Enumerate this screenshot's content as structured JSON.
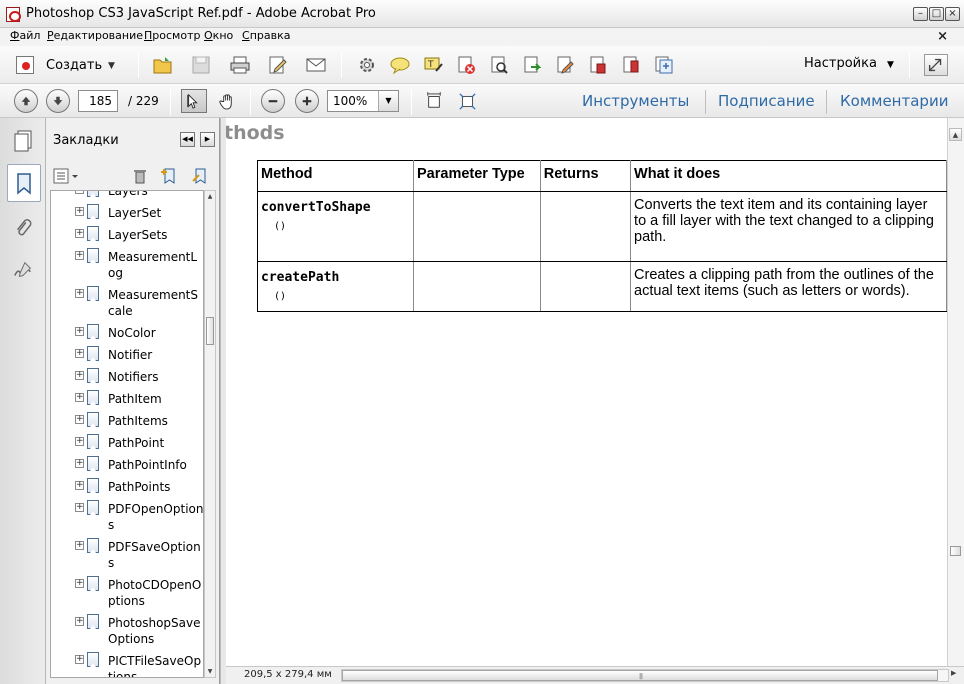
{
  "window": {
    "title": "Photoshop CS3 JavaScript Ref.pdf - Adobe Acrobat Pro",
    "minimize": "–",
    "maximize": "□",
    "close": "×"
  },
  "menu": {
    "items": [
      "Файл",
      "Редактирование",
      "Просмотр",
      "Окно",
      "Справка"
    ],
    "close_doc": "×"
  },
  "toolbar": {
    "create_label": "Создать",
    "create_arrow": "▼",
    "settings_label": "Настройка",
    "settings_arrow": "▼"
  },
  "navigation": {
    "current_page": "185",
    "total_pages": "/ 229",
    "zoom": "100%",
    "zoom_arrow": "▼",
    "panel_tabs": [
      "Инструменты",
      "Подписание",
      "Комментарии"
    ]
  },
  "bookmarks": {
    "title": "Закладки",
    "items": [
      "Layers",
      "LayerSet",
      "LayerSets",
      "MeasurementLog",
      "MeasurementScale",
      "NoColor",
      "Notifier",
      "Notifiers",
      "PathItem",
      "PathItems",
      "PathPoint",
      "PathPointInfo",
      "PathPoints",
      "PDFOpenOptions",
      "PDFSaveOptions",
      "PhotoCDOpenOptions",
      "PhotoshopSaveOptions",
      "PICTFileSaveOptions"
    ]
  },
  "document": {
    "section_title": "thods",
    "table": {
      "headers": [
        "Method",
        "Parameter Type",
        "Returns",
        "What it does"
      ],
      "rows": [
        {
          "method": "convertToShape",
          "args": "()",
          "parameter_type": "",
          "returns": "",
          "description": "Converts the text item and its containing layer to a fill layer with the text changed to a clipping path."
        },
        {
          "method": "createPath",
          "args": "()",
          "parameter_type": "",
          "returns": "",
          "description": "Creates a clipping path from the outlines of the actual text items (such as letters or words)."
        }
      ]
    }
  },
  "status": {
    "page_size": "209,5 x 279,4 мм"
  },
  "colors": {
    "panel_tab_text": "#2e6aa6",
    "section_title": "#8d8d8d"
  }
}
